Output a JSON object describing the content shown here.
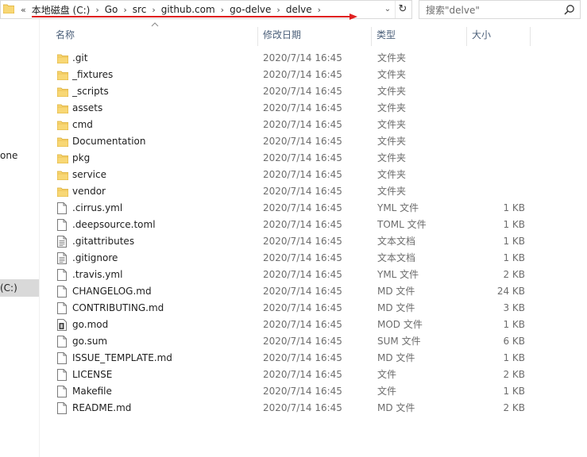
{
  "address": {
    "overflow": "«",
    "crumbs": [
      "本地磁盘 (C:)",
      "Go",
      "src",
      "github.com",
      "go-delve",
      "delve"
    ],
    "separator": "›"
  },
  "search": {
    "placeholder": "搜索\"delve\""
  },
  "nav": {
    "item_1": "one",
    "item_2": "(C:)"
  },
  "columns": {
    "name": "名称",
    "date": "修改日期",
    "type": "类型",
    "size": "大小"
  },
  "colors": {
    "folder": "#f8d775",
    "selected": "#d9d9d9",
    "header_text": "#4c607a",
    "arrow": "#e02020"
  },
  "files": [
    {
      "name": ".git",
      "date": "2020/7/14 16:45",
      "type": "文件夹",
      "size": "",
      "icon": "folder-icon"
    },
    {
      "name": "_fixtures",
      "date": "2020/7/14 16:45",
      "type": "文件夹",
      "size": "",
      "icon": "folder-icon"
    },
    {
      "name": "_scripts",
      "date": "2020/7/14 16:45",
      "type": "文件夹",
      "size": "",
      "icon": "folder-icon"
    },
    {
      "name": "assets",
      "date": "2020/7/14 16:45",
      "type": "文件夹",
      "size": "",
      "icon": "folder-icon"
    },
    {
      "name": "cmd",
      "date": "2020/7/14 16:45",
      "type": "文件夹",
      "size": "",
      "icon": "folder-icon"
    },
    {
      "name": "Documentation",
      "date": "2020/7/14 16:45",
      "type": "文件夹",
      "size": "",
      "icon": "folder-icon"
    },
    {
      "name": "pkg",
      "date": "2020/7/14 16:45",
      "type": "文件夹",
      "size": "",
      "icon": "folder-icon"
    },
    {
      "name": "service",
      "date": "2020/7/14 16:45",
      "type": "文件夹",
      "size": "",
      "icon": "folder-icon"
    },
    {
      "name": "vendor",
      "date": "2020/7/14 16:45",
      "type": "文件夹",
      "size": "",
      "icon": "folder-icon"
    },
    {
      "name": ".cirrus.yml",
      "date": "2020/7/14 16:45",
      "type": "YML 文件",
      "size": "1 KB",
      "icon": "file-icon"
    },
    {
      "name": ".deepsource.toml",
      "date": "2020/7/14 16:45",
      "type": "TOML 文件",
      "size": "1 KB",
      "icon": "file-icon"
    },
    {
      "name": ".gitattributes",
      "date": "2020/7/14 16:45",
      "type": "文本文档",
      "size": "1 KB",
      "icon": "text-file-icon"
    },
    {
      "name": ".gitignore",
      "date": "2020/7/14 16:45",
      "type": "文本文档",
      "size": "1 KB",
      "icon": "text-file-icon"
    },
    {
      "name": ".travis.yml",
      "date": "2020/7/14 16:45",
      "type": "YML 文件",
      "size": "2 KB",
      "icon": "file-icon"
    },
    {
      "name": "CHANGELOG.md",
      "date": "2020/7/14 16:45",
      "type": "MD 文件",
      "size": "24 KB",
      "icon": "file-icon"
    },
    {
      "name": "CONTRIBUTING.md",
      "date": "2020/7/14 16:45",
      "type": "MD 文件",
      "size": "3 KB",
      "icon": "file-icon"
    },
    {
      "name": "go.mod",
      "date": "2020/7/14 16:45",
      "type": "MOD 文件",
      "size": "1 KB",
      "icon": "mod-file-icon"
    },
    {
      "name": "go.sum",
      "date": "2020/7/14 16:45",
      "type": "SUM 文件",
      "size": "6 KB",
      "icon": "file-icon"
    },
    {
      "name": "ISSUE_TEMPLATE.md",
      "date": "2020/7/14 16:45",
      "type": "MD 文件",
      "size": "1 KB",
      "icon": "file-icon"
    },
    {
      "name": "LICENSE",
      "date": "2020/7/14 16:45",
      "type": "文件",
      "size": "2 KB",
      "icon": "file-icon"
    },
    {
      "name": "Makefile",
      "date": "2020/7/14 16:45",
      "type": "文件",
      "size": "1 KB",
      "icon": "file-icon"
    },
    {
      "name": "README.md",
      "date": "2020/7/14 16:45",
      "type": "MD 文件",
      "size": "2 KB",
      "icon": "file-icon"
    }
  ]
}
